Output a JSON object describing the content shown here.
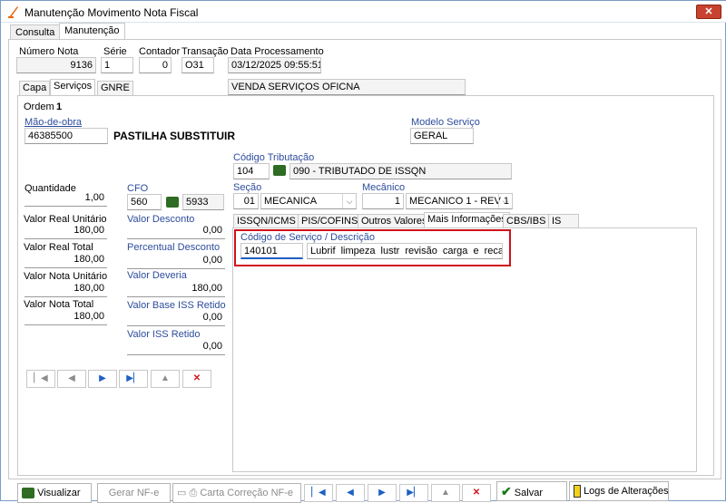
{
  "window": {
    "title": "Manutenção Movimento Nota Fiscal",
    "close_label": "✕"
  },
  "main_tabs": [
    "Consulta",
    "Manutenção"
  ],
  "header": {
    "numero_nota": {
      "label": "Número Nota",
      "value": "9136"
    },
    "serie": {
      "label": "Série",
      "value": "1"
    },
    "contador": {
      "label": "Contador",
      "value": "0"
    },
    "transacao": {
      "label": "Transação",
      "value": "O31"
    },
    "data_processamento": {
      "label": "Data Processamento",
      "value": "03/12/2025 09:55:51"
    },
    "operacao_text": "VENDA SERVIÇOS OFICNA"
  },
  "sub_tabs": [
    "Capa",
    "Serviços",
    "GNRE"
  ],
  "ordem": {
    "label": "Ordem",
    "value": "1"
  },
  "mao_de_obra": {
    "label": "Mão-de-obra",
    "code": "46385500",
    "description": "PASTILHA SUBSTITUIR"
  },
  "modelo_servico": {
    "label": "Modelo Serviço",
    "value": "GERAL"
  },
  "codigo_tributacao": {
    "label": "Código Tributação",
    "code": "104",
    "description": "090 - TRIBUTADO DE ISSQN"
  },
  "quantidade": {
    "label": "Quantidade",
    "value": "1,00"
  },
  "cfo": {
    "label": "CFO",
    "code": "560",
    "description": "5933"
  },
  "secao": {
    "label": "Seção",
    "code": "01",
    "value": "MECANICA"
  },
  "mecanico": {
    "label": "Mecânico",
    "code": "1",
    "value": "MECANICO 1 - REV 1"
  },
  "valores_esq": [
    {
      "label": "Valor Real Unitário",
      "value": "180,00"
    },
    {
      "label": "Valor Real Total",
      "value": "180,00"
    },
    {
      "label": "Valor Nota Unitário",
      "value": "180,00"
    },
    {
      "label": "Valor Nota Total",
      "value": "180,00"
    }
  ],
  "valores_dir": [
    {
      "label": "Valor Desconto",
      "value": "0,00"
    },
    {
      "label": "Percentual Desconto",
      "value": "0,00"
    },
    {
      "label": "Valor Deveria",
      "value": "180,00"
    },
    {
      "label": "Valor Base ISS Retido",
      "value": "0,00"
    },
    {
      "label": "Valor ISS Retido",
      "value": "0,00"
    }
  ],
  "detail_tabs": [
    "ISSQN/ICMS",
    "PIS/COFINS",
    "Outros Valores",
    "Mais Informações",
    "CBS/IBS",
    "IS"
  ],
  "codigo_servico": {
    "label": "Código de Serviço / Descrição",
    "code": "140101",
    "description": "Lubrif limpeza lustr revisão carga e recarga co"
  },
  "nav_icons": [
    "first-icon",
    "prev-icon",
    "next-icon",
    "last-icon",
    "up-icon",
    "delete-icon"
  ],
  "bottom_buttons": {
    "visualizar": "Visualizar",
    "gerar_nfe": "Gerar NF-e",
    "carta_correcao": "Carta Correção NF-e",
    "salvar": "Salvar",
    "logs": "Logs de Alterações"
  },
  "colors": {
    "accent_blue": "#1d5fc4",
    "highlight_red": "#d0111b",
    "label_blue": "#2c4c9c"
  }
}
